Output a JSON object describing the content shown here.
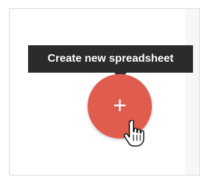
{
  "tooltip": {
    "text": "Create new spreadsheet"
  },
  "fab": {
    "label": "+"
  },
  "colors": {
    "fab": "#e05c4f",
    "tooltip_bg": "#2b2b2b",
    "tooltip_text": "#ffffff"
  },
  "icons": {
    "cursor": "hand-pointer-icon",
    "plus": "plus-icon"
  }
}
